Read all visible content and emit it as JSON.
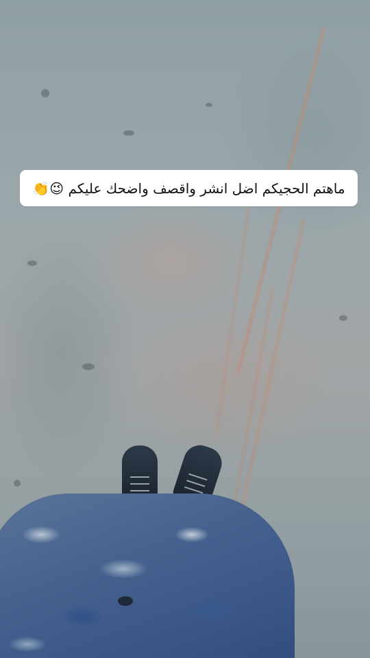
{
  "caption": {
    "text": "ماهتم الحجيكم اضل انشر واقصف واضحك عليكم 😉👏"
  }
}
